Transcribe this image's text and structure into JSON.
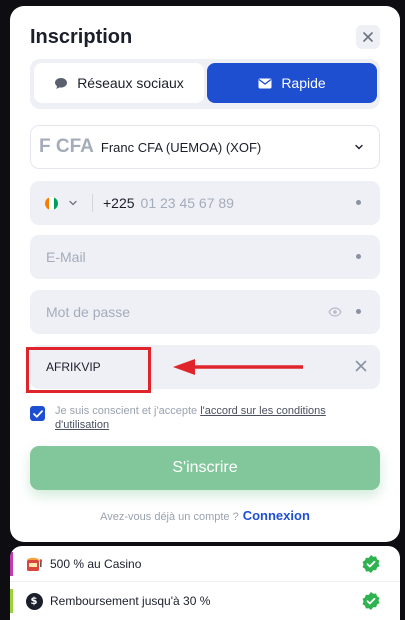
{
  "title": "Inscription",
  "tabs": {
    "social": "Réseaux sociaux",
    "quick": "Rapide"
  },
  "currency": {
    "code": "F CFA",
    "name": "Franc CFA (UEMOA) (XOF)"
  },
  "phone": {
    "dial_code": "+225",
    "placeholder": "01 23 45 67 89"
  },
  "email": {
    "placeholder": "E-Mail"
  },
  "password": {
    "placeholder": "Mot de passe"
  },
  "promo": {
    "value": "AFRIKVIP"
  },
  "consent": {
    "text": "Je suis conscient et j'accepte ",
    "link": "l'accord sur les conditions d'utilisation"
  },
  "submit": {
    "label": "S'inscrire"
  },
  "login": {
    "question": "Avez-vous déjà un compte ?",
    "link": "Connexion"
  },
  "bonuses": [
    {
      "label": "500 % au Casino",
      "icon": "slot-machine-icon"
    },
    {
      "label": "Remboursement jusqu'à 30 %",
      "icon": "coin-icon",
      "icon_text": "$"
    }
  ],
  "colors": {
    "primary": "#1f4fd1",
    "submit": "#82c79b",
    "annotation_red": "#e0242b",
    "success": "#2fb350"
  }
}
